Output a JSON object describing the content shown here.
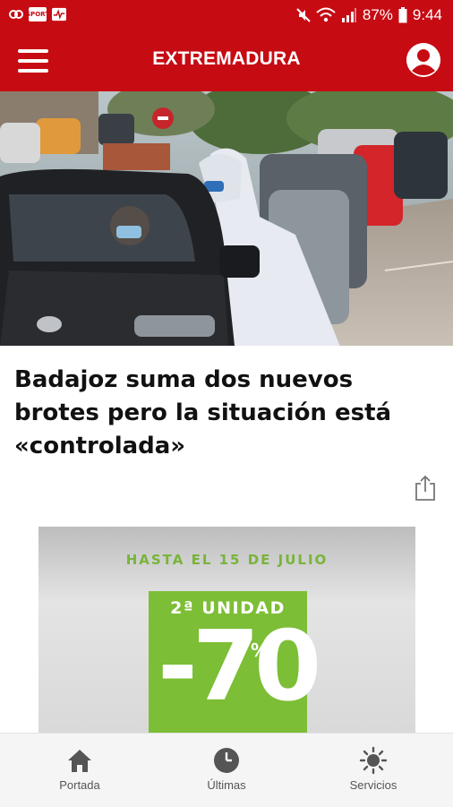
{
  "status_bar": {
    "battery": "87%",
    "time": "9:44",
    "app_icon_text": "SPORT"
  },
  "app_bar": {
    "title": "EXTREMADURA"
  },
  "article": {
    "headline": "Badajoz suma dos nuevos brotes pero la situación está «controlada»"
  },
  "ad": {
    "top_text": "HASTA EL 15 DE JULIO",
    "unit_text": "2ª UNIDAD",
    "discount": "-70",
    "percent": "%"
  },
  "bottom_nav": {
    "items": [
      {
        "label": "Portada",
        "icon": "home-icon"
      },
      {
        "label": "Últimas",
        "icon": "clock-icon"
      },
      {
        "label": "Servicios",
        "icon": "sun-icon"
      }
    ]
  },
  "colors": {
    "brand": "#c60b13",
    "ad_green": "#7cbe35"
  }
}
